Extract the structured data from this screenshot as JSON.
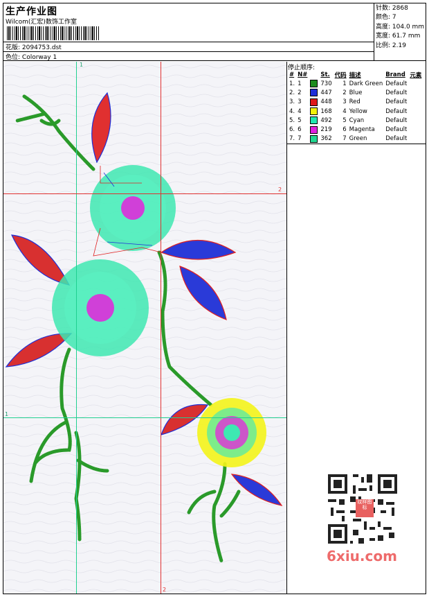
{
  "header": {
    "title": "生产作业图",
    "studio": "Wilcom(汇宏)数饰工作室",
    "design_label": "花版:",
    "design_file": "2094753.dst",
    "colorway_label": "色位:",
    "colorway": "Colorway 1"
  },
  "stats": [
    {
      "label": "针数:",
      "value": "2868"
    },
    {
      "label": "颜色:",
      "value": "7"
    },
    {
      "label": "高度:",
      "value": "104.0 mm"
    },
    {
      "label": "宽度:",
      "value": "61.7 mm"
    },
    {
      "label": "比例:",
      "value": "2.19"
    }
  ],
  "guides": {
    "v1_label": "1",
    "v2_label": "2",
    "h1_label": "1",
    "h2_label": "2",
    "bottom2_label": "2"
  },
  "panel": {
    "title": "停止顺序:",
    "headers": [
      "#",
      "N#",
      "St.",
      "代码",
      "描述",
      "Brand",
      "元素"
    ],
    "rows": [
      {
        "num": "1.",
        "n": "1",
        "color": "#1e8c1e",
        "st": "730",
        "code": "1",
        "desc": "Dark Green",
        "brand": "Default"
      },
      {
        "num": "2.",
        "n": "2",
        "color": "#1e2fd8",
        "st": "447",
        "code": "2",
        "desc": "Blue",
        "brand": "Default"
      },
      {
        "num": "3.",
        "n": "3",
        "color": "#e01818",
        "st": "448",
        "code": "3",
        "desc": "Red",
        "brand": "Default"
      },
      {
        "num": "4.",
        "n": "4",
        "color": "#f2f20a",
        "st": "168",
        "code": "4",
        "desc": "Yellow",
        "brand": "Default"
      },
      {
        "num": "5.",
        "n": "5",
        "color": "#20e8b0",
        "st": "492",
        "code": "5",
        "desc": "Cyan",
        "brand": "Default"
      },
      {
        "num": "6.",
        "n": "6",
        "color": "#e020e0",
        "st": "219",
        "code": "6",
        "desc": "Magenta",
        "brand": "Default"
      },
      {
        "num": "7.",
        "n": "7",
        "color": "#20d890",
        "st": "362",
        "code": "7",
        "desc": "Green",
        "brand": "Default"
      }
    ]
  },
  "watermark": "6xiu.com",
  "stamp": "纹样图标"
}
